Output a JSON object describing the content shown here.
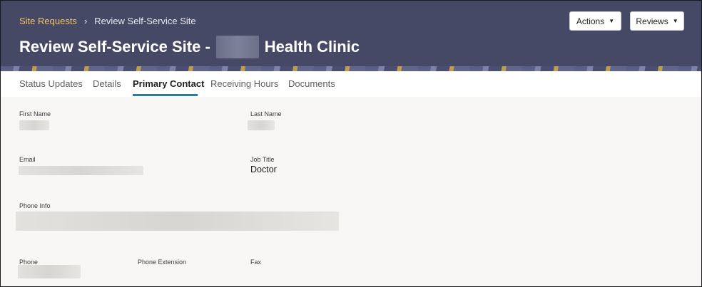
{
  "breadcrumb": {
    "parent": "Site Requests",
    "separator": "›",
    "current": "Review Self-Service Site"
  },
  "page": {
    "title_prefix": "Review Self-Service Site -",
    "title_suffix": "Health Clinic"
  },
  "header_buttons": {
    "actions": "Actions",
    "reviews": "Reviews",
    "caret": "▼"
  },
  "tabs": [
    {
      "label": "Status Updates"
    },
    {
      "label": "Details"
    },
    {
      "label": "Primary Contact"
    },
    {
      "label": "Receiving Hours"
    },
    {
      "label": "Documents"
    }
  ],
  "active_tab": "Primary Contact",
  "fields": {
    "first_name": {
      "label": "First Name"
    },
    "last_name": {
      "label": "Last Name"
    },
    "email": {
      "label": "Email"
    },
    "job_title": {
      "label": "Job Title",
      "value": "Doctor"
    },
    "phone_info": {
      "label": "Phone Info"
    },
    "phone": {
      "label": "Phone"
    },
    "phone_extension": {
      "label": "Phone Extension"
    },
    "fax": {
      "label": "Fax"
    }
  },
  "colors": {
    "header_bg": "#454966",
    "breadcrumb_link": "#f0c466",
    "active_tab_underline": "#2f7d95",
    "content_bg": "#f8f7f5"
  }
}
